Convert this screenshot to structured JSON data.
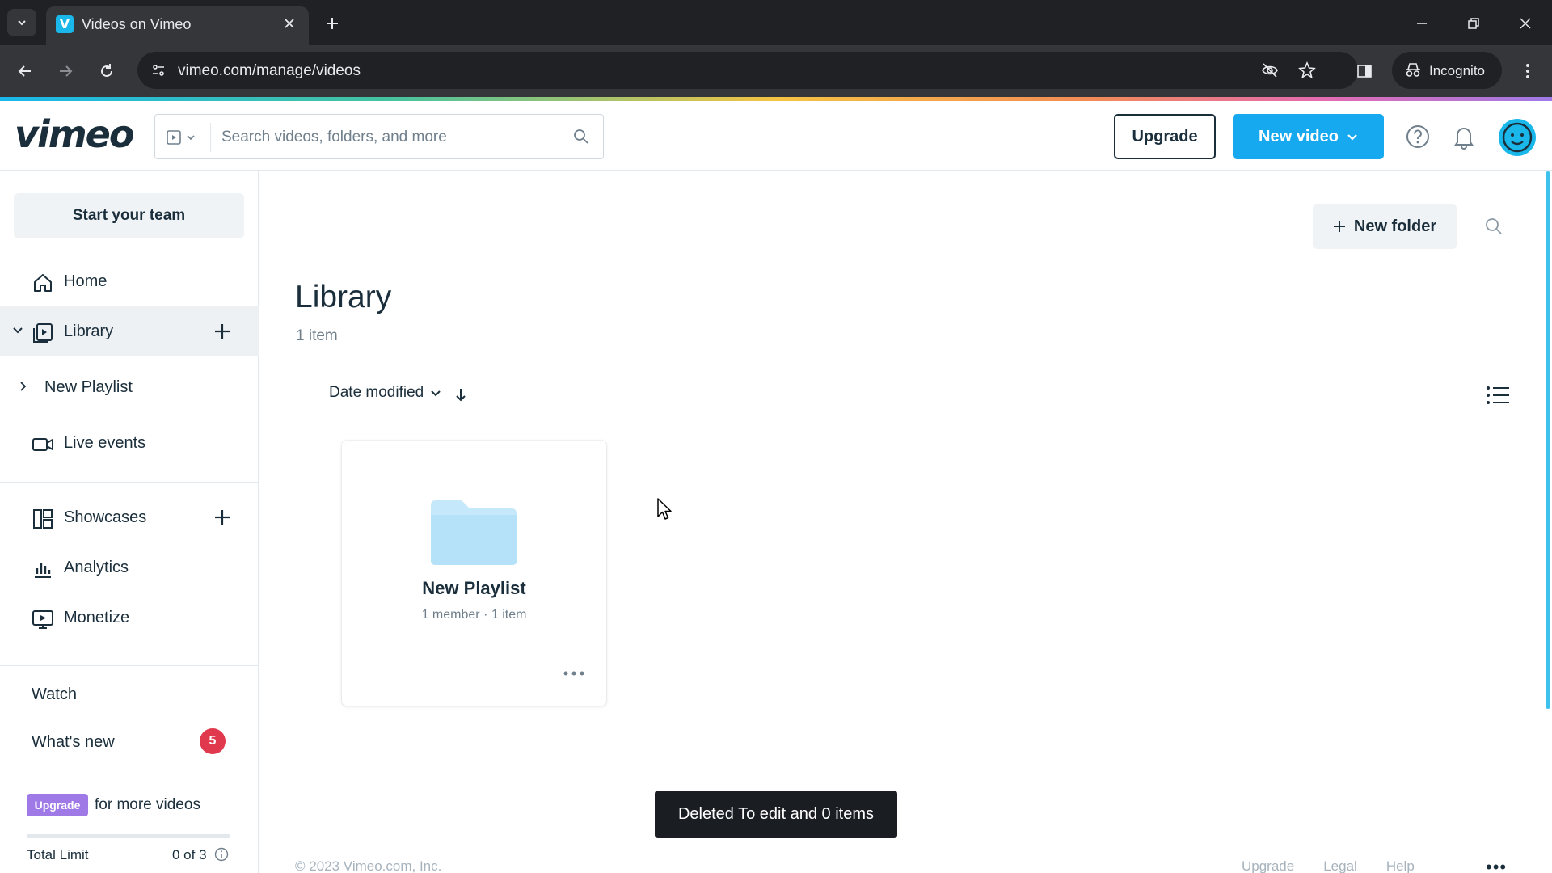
{
  "browser": {
    "tab_title": "Videos on Vimeo",
    "favicon_letter": "V",
    "url": "vimeo.com/manage/videos",
    "incognito_label": "Incognito"
  },
  "header": {
    "logo": "vimeo",
    "search_placeholder": "Search videos, folders, and more",
    "upgrade_label": "Upgrade",
    "new_video_label": "New video"
  },
  "sidebar": {
    "team_button": "Start your team",
    "items": [
      {
        "label": "Home",
        "icon": "home-icon"
      },
      {
        "label": "Library",
        "icon": "library-icon",
        "active": true
      },
      {
        "label": "New Playlist",
        "icon": "chevron-right-icon"
      },
      {
        "label": "Live events",
        "icon": "camera-icon"
      },
      {
        "label": "Showcases",
        "icon": "showcases-icon"
      },
      {
        "label": "Analytics",
        "icon": "bar-chart-icon"
      },
      {
        "label": "Monetize",
        "icon": "monetize-icon"
      }
    ],
    "watch_label": "Watch",
    "whats_new_label": "What's new",
    "whats_new_count": "5",
    "upgrade_pill": "Upgrade",
    "upgrade_text": "for more videos",
    "limit_label": "Total Limit",
    "limit_value": "0 of 3"
  },
  "main": {
    "new_folder_label": "New folder",
    "title": "Library",
    "item_count": "1 item",
    "sort_label": "Date modified",
    "folder_card": {
      "title": "New Playlist",
      "members": "1 member",
      "items": "1 item"
    }
  },
  "toast": "Deleted To edit and 0 items",
  "footer": {
    "copyright": "© 2023 Vimeo.com, Inc.",
    "links": [
      "Upgrade",
      "Legal",
      "Help"
    ]
  },
  "colors": {
    "accent": "#17a9ef",
    "badge": "#e0394d",
    "upgrade_pill": "#9f7ae7",
    "text": "#1a2e3b"
  }
}
